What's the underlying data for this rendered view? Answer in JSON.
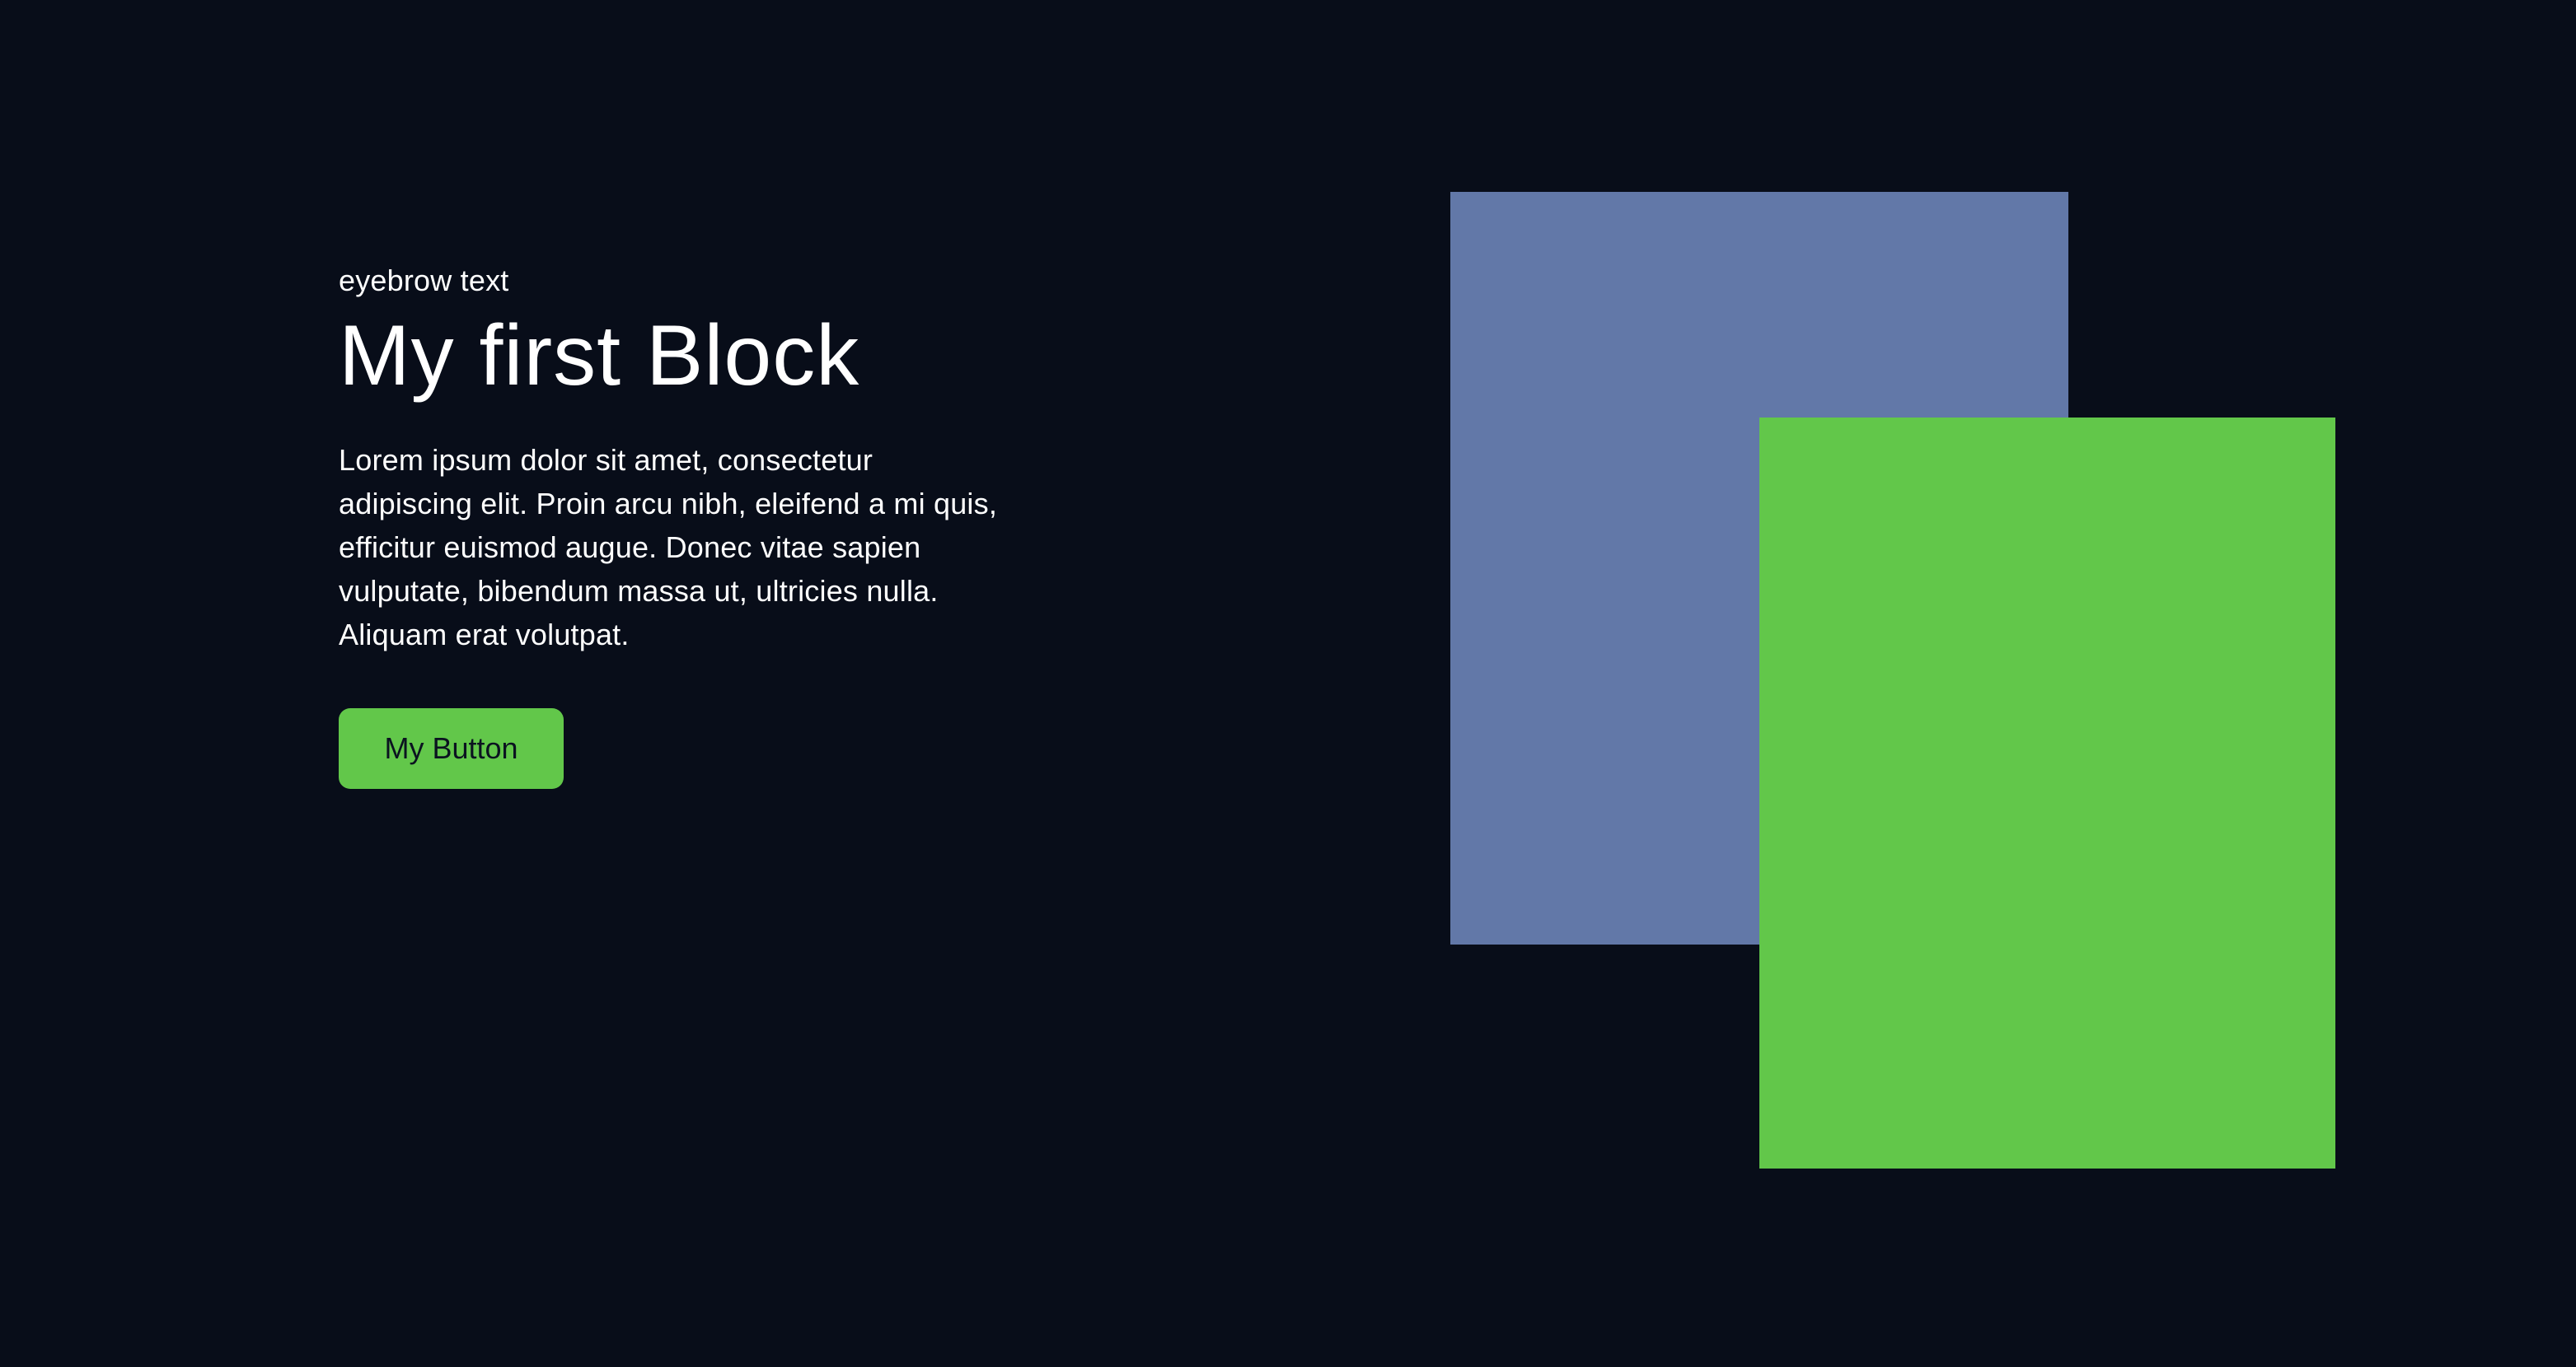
{
  "hero": {
    "eyebrow": "eyebrow text",
    "title": "My first Block",
    "body": "Lorem ipsum dolor sit amet, consectetur adipiscing elit. Proin arcu nibh, eleifend a mi quis, efficitur euismod augue. Donec vitae sapien vulputate, bibendum massa ut, ultricies nulla. Aliquam erat volutpat.",
    "button_label": "My Button"
  },
  "colors": {
    "background": "#080d19",
    "text": "#ffffff",
    "accent_green": "#62c74a",
    "panel_blue": "#6278a8",
    "button_text": "#0b1320"
  }
}
